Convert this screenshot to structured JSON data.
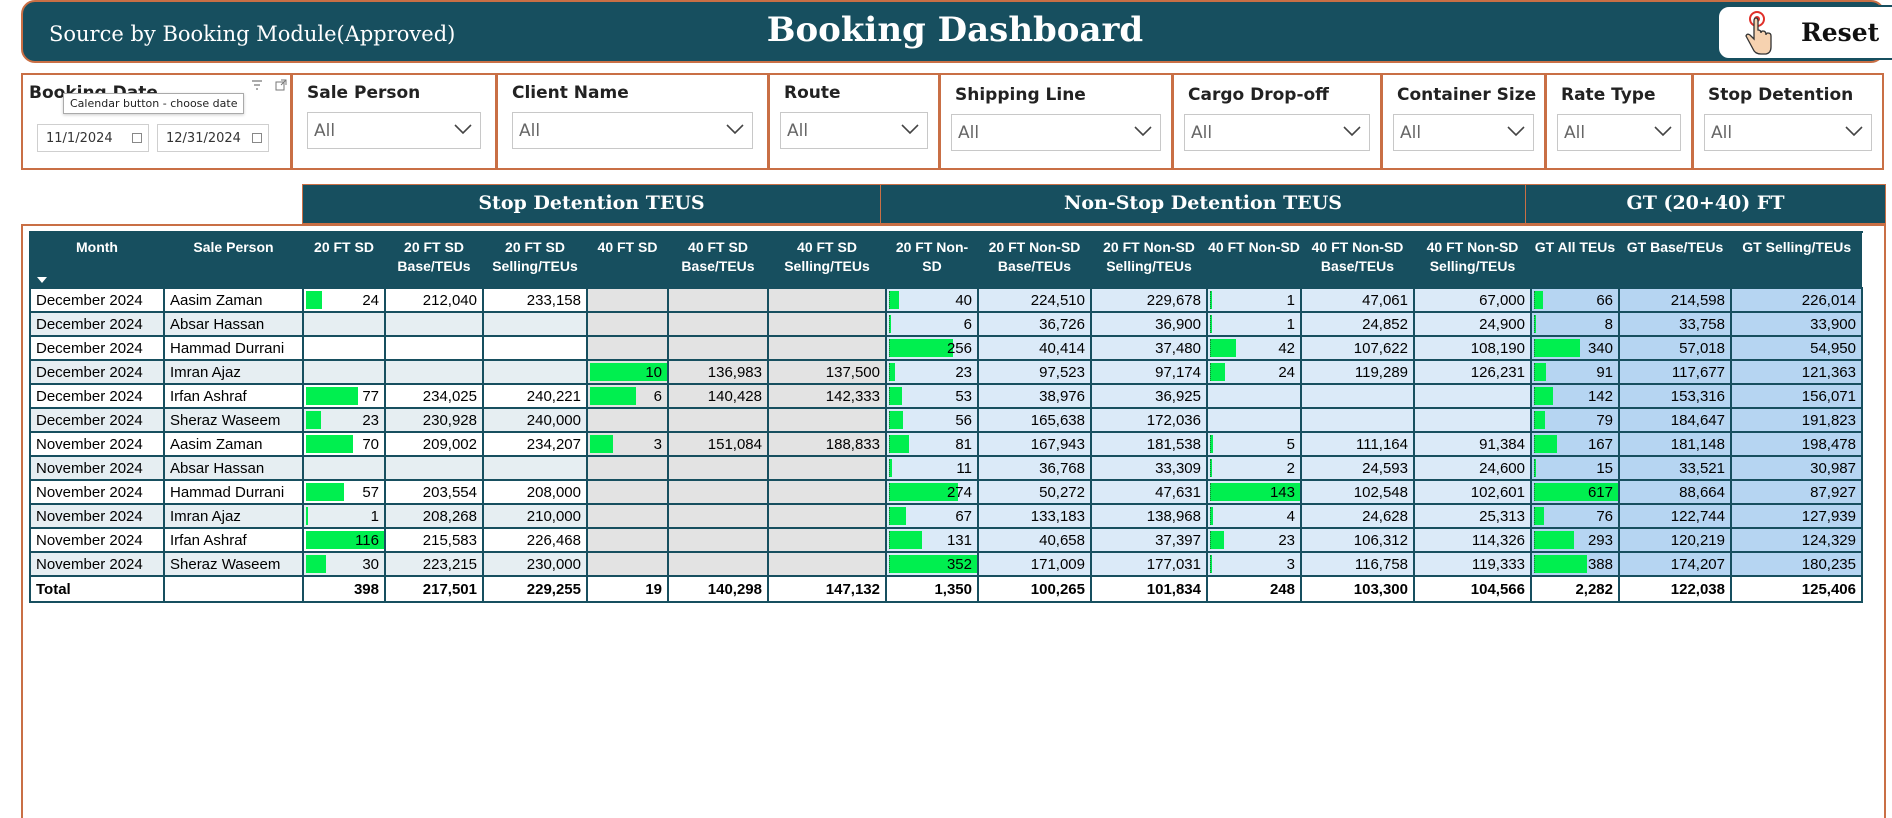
{
  "header": {
    "source": "Source by Booking Module(Approved)",
    "title": "Booking Dashboard",
    "reset_label": "Reset"
  },
  "slicers": {
    "booking_date": {
      "title": "Booking Date",
      "tooltip": "Calendar button - choose date",
      "start": "11/1/2024",
      "end": "12/31/2024"
    },
    "sale_person": {
      "title": "Sale Person",
      "value": "All"
    },
    "client_name": {
      "title": "Client Name",
      "value": "All"
    },
    "route": {
      "title": "Route",
      "value": "All"
    },
    "shipping_line": {
      "title": "Shipping Line",
      "value": "All"
    },
    "cargo_dropoff": {
      "title": "Cargo Drop-off",
      "value": "All"
    },
    "container_size": {
      "title": "Container Size",
      "value": "All"
    },
    "rate_type": {
      "title": "Rate Type",
      "value": "All"
    },
    "stop_detention": {
      "title": "Stop Detention",
      "value": "All"
    }
  },
  "groups": {
    "sd": "Stop Detention TEUS",
    "nsd": "Non-Stop Detention TEUS",
    "gt": "GT (20+40) FT"
  },
  "columns": [
    "Month",
    "Sale Person",
    "20 FT SD",
    "20 FT SD Base/TEUs",
    "20 FT SD Selling/TEUs",
    "40 FT SD",
    "40 FT SD Base/TEUs",
    "40 FT SD Selling/TEUs",
    "20 FT Non-SD",
    "20 FT Non-SD Base/TEUs",
    "20 FT Non-SD Selling/TEUs",
    "40 FT Non-SD",
    "40 FT Non-SD Base/TEUs",
    "40 FT Non-SD Selling/TEUs",
    "GT All TEUs",
    "GT Base/TEUs",
    "GT Selling/TEUs"
  ],
  "rows": [
    [
      "December 2024",
      "Aasim Zaman",
      "24",
      "212,040",
      "233,158",
      "",
      "",
      "",
      "40",
      "224,510",
      "229,678",
      "1",
      "47,061",
      "67,000",
      "66",
      "214,598",
      "226,014"
    ],
    [
      "December 2024",
      "Absar Hassan",
      "",
      "",
      "",
      "",
      "",
      "",
      "6",
      "36,726",
      "36,900",
      "1",
      "24,852",
      "24,900",
      "8",
      "33,758",
      "33,900"
    ],
    [
      "December 2024",
      "Hammad Durrani",
      "",
      "",
      "",
      "",
      "",
      "",
      "256",
      "40,414",
      "37,480",
      "42",
      "107,622",
      "108,190",
      "340",
      "57,018",
      "54,950"
    ],
    [
      "December 2024",
      "Imran Ajaz",
      "",
      "",
      "",
      "10",
      "136,983",
      "137,500",
      "23",
      "97,523",
      "97,174",
      "24",
      "119,289",
      "126,231",
      "91",
      "117,677",
      "121,363"
    ],
    [
      "December 2024",
      "Irfan Ashraf",
      "77",
      "234,025",
      "240,221",
      "6",
      "140,428",
      "142,333",
      "53",
      "38,976",
      "36,925",
      "",
      "",
      "",
      "142",
      "153,316",
      "156,071"
    ],
    [
      "December 2024",
      "Sheraz Waseem",
      "23",
      "230,928",
      "240,000",
      "",
      "",
      "",
      "56",
      "165,638",
      "172,036",
      "",
      "",
      "",
      "79",
      "184,647",
      "191,823"
    ],
    [
      "November 2024",
      "Aasim Zaman",
      "70",
      "209,002",
      "234,207",
      "3",
      "151,084",
      "188,833",
      "81",
      "167,943",
      "181,538",
      "5",
      "111,164",
      "91,384",
      "167",
      "181,148",
      "198,478"
    ],
    [
      "November 2024",
      "Absar Hassan",
      "",
      "",
      "",
      "",
      "",
      "",
      "11",
      "36,768",
      "33,309",
      "2",
      "24,593",
      "24,600",
      "15",
      "33,521",
      "30,987"
    ],
    [
      "November 2024",
      "Hammad Durrani",
      "57",
      "203,554",
      "208,000",
      "",
      "",
      "",
      "274",
      "50,272",
      "47,631",
      "143",
      "102,548",
      "102,601",
      "617",
      "88,664",
      "87,927"
    ],
    [
      "November 2024",
      "Imran Ajaz",
      "1",
      "208,268",
      "210,000",
      "",
      "",
      "",
      "67",
      "133,183",
      "138,968",
      "4",
      "24,628",
      "25,313",
      "76",
      "122,744",
      "127,939"
    ],
    [
      "November 2024",
      "Irfan Ashraf",
      "116",
      "215,583",
      "226,468",
      "",
      "",
      "",
      "131",
      "40,658",
      "37,397",
      "23",
      "106,312",
      "114,326",
      "293",
      "120,219",
      "124,329"
    ],
    [
      "November 2024",
      "Sheraz Waseem",
      "30",
      "223,215",
      "230,000",
      "",
      "",
      "",
      "352",
      "171,009",
      "177,031",
      "3",
      "116,758",
      "119,333",
      "388",
      "174,207",
      "180,235"
    ]
  ],
  "totals": [
    "Total",
    "",
    "398",
    "217,501",
    "229,255",
    "19",
    "140,298",
    "147,132",
    "1,350",
    "100,265",
    "101,834",
    "248",
    "103,300",
    "104,566",
    "2,282",
    "122,038",
    "125,406"
  ],
  "bar_color": "#00ef4f",
  "header_color": "#174f5f"
}
